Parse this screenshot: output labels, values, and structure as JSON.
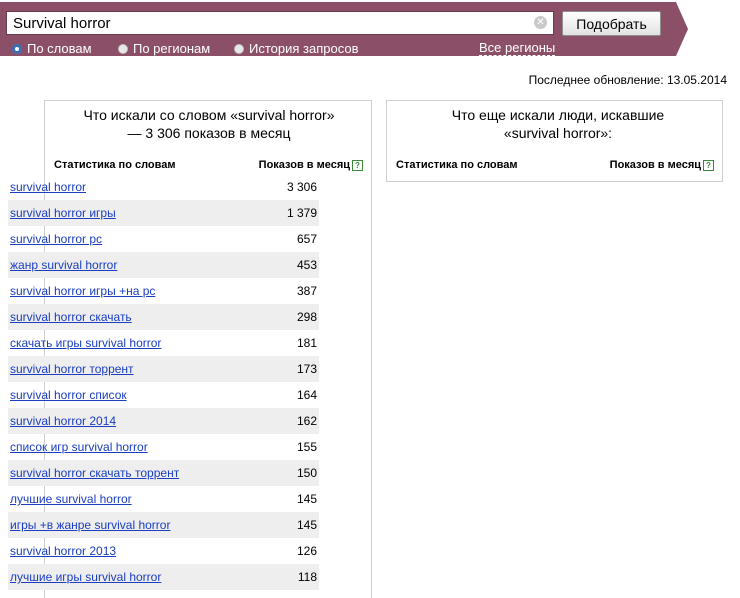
{
  "search": {
    "query": "Survival horror",
    "submit_label": "Подобрать",
    "modes": [
      {
        "label": "По словам",
        "selected": true
      },
      {
        "label": "По регионам",
        "selected": false
      },
      {
        "label": "История запросов",
        "selected": false
      }
    ],
    "regions_link": "Все регионы"
  },
  "last_update": "Последнее обновление: 13.05.2014",
  "left_panel": {
    "title": "Что искали со словом «survival horror» — 3 306 показов в месяц",
    "col_phrase": "Статистика по словам",
    "col_count": "Показов в месяц",
    "help": "?",
    "rows": [
      {
        "phrase": "survival horror",
        "count": "3 306"
      },
      {
        "phrase": "survival horror игры",
        "count": "1 379"
      },
      {
        "phrase": "survival horror pc",
        "count": "657"
      },
      {
        "phrase": "жанр survival horror",
        "count": "453"
      },
      {
        "phrase": "survival horror игры +на pc",
        "count": "387"
      },
      {
        "phrase": "survival horror скачать",
        "count": "298"
      },
      {
        "phrase": "скачать игры survival horror",
        "count": "181"
      },
      {
        "phrase": "survival horror торрент",
        "count": "173"
      },
      {
        "phrase": "survival horror список",
        "count": "164"
      },
      {
        "phrase": "survival horror 2014",
        "count": "162"
      },
      {
        "phrase": "список игр survival horror",
        "count": "155"
      },
      {
        "phrase": "survival horror скачать торрент",
        "count": "150"
      },
      {
        "phrase": "лучшие survival horror",
        "count": "145"
      },
      {
        "phrase": "игры +в жанре survival horror",
        "count": "145"
      },
      {
        "phrase": "survival horror 2013",
        "count": "126"
      },
      {
        "phrase": "лучшие игры survival horror",
        "count": "118"
      }
    ]
  },
  "right_panel": {
    "title": "Что еще искали люди, искавшие «survival horror»:",
    "col_phrase": "Статистика по словам",
    "col_count": "Показов в месяц",
    "help": "?"
  }
}
